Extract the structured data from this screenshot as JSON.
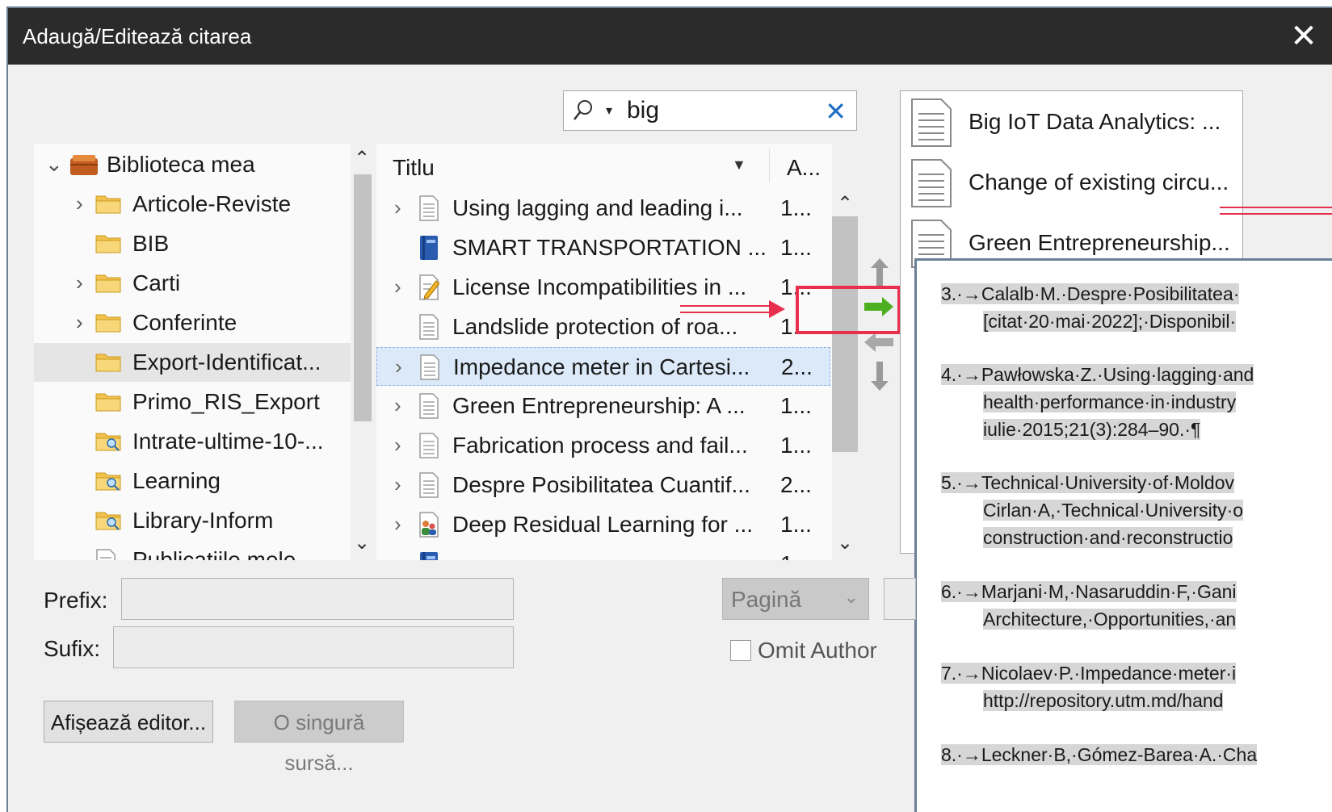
{
  "window": {
    "title": "Adaugă/Editează citarea",
    "close_glyph": "✕"
  },
  "search": {
    "value": "big",
    "clear_glyph": "✕",
    "dropdown_glyph": "▾"
  },
  "tree": {
    "items": [
      {
        "label": "Biblioteca mea",
        "expand": "⌄",
        "icon": "library-icon"
      },
      {
        "label": "Articole-Reviste",
        "expand": "›",
        "icon": "folder-icon"
      },
      {
        "label": "BIB",
        "expand": "",
        "icon": "folder-icon"
      },
      {
        "label": "Carti",
        "expand": "›",
        "icon": "folder-icon"
      },
      {
        "label": "Conferinte",
        "expand": "›",
        "icon": "folder-icon"
      },
      {
        "label": "Export-Identificat...",
        "expand": "",
        "icon": "folder-icon",
        "selected": true
      },
      {
        "label": "Primo_RIS_Export",
        "expand": "",
        "icon": "folder-icon"
      },
      {
        "label": "Intrate-ultime-10-...",
        "expand": "",
        "icon": "search-folder-icon"
      },
      {
        "label": "Learning",
        "expand": "",
        "icon": "search-folder-icon"
      },
      {
        "label": "Library-Inform",
        "expand": "",
        "icon": "search-folder-icon"
      },
      {
        "label": "Publicatiile mele",
        "expand": "",
        "icon": "document-icon"
      }
    ]
  },
  "list": {
    "col_title": "Titlu",
    "col_author": "A...",
    "rows": [
      {
        "title": "Using lagging and leading i...",
        "author": "1...",
        "expand": "›",
        "icon": "document-icon"
      },
      {
        "title": "SMART TRANSPORTATION ...",
        "author": "1...",
        "expand": "",
        "icon": "book-icon"
      },
      {
        "title": "License Incompatibilities in ...",
        "author": "1...",
        "expand": "›",
        "icon": "edit-document-icon"
      },
      {
        "title": "Landslide protection of roa...",
        "author": "1...",
        "expand": "",
        "icon": "document-icon"
      },
      {
        "title": "Impedance meter in Cartesi...",
        "author": "2...",
        "expand": "›",
        "icon": "document-icon",
        "selected": true
      },
      {
        "title": "Green Entrepreneurship: A ...",
        "author": "1...",
        "expand": "›",
        "icon": "document-icon"
      },
      {
        "title": "Fabrication process and fail...",
        "author": "1...",
        "expand": "›",
        "icon": "document-icon"
      },
      {
        "title": "Despre Posibilitatea Cuantif...",
        "author": "2...",
        "expand": "›",
        "icon": "document-icon"
      },
      {
        "title": "Deep Residual Learning for ...",
        "author": "1...",
        "expand": "›",
        "icon": "people-document-icon"
      },
      {
        "title": "",
        "author": "1...",
        "expand": "›",
        "icon": "book-icon"
      }
    ]
  },
  "selected_citations": [
    {
      "title": "Big IoT Data Analytics: ..."
    },
    {
      "title": "Change of existing circu..."
    },
    {
      "title": "Green Entrepreneurship..."
    }
  ],
  "document": {
    "entries": [
      {
        "lines": [
          "3.·→Calalb·M.·Despre·Posibilitatea·",
          "[citat·20·mai·2022];·Disponibil·"
        ]
      },
      {
        "lines": [
          "4.·→Pawłowska·Z.·Using·lagging·and",
          "health·performance·in·industry",
          "iulie·2015;21(3):284–90.·¶"
        ]
      },
      {
        "lines": [
          "5.·→Technical·University·of·Moldov",
          "Cirlan·A,·Technical·University·o",
          "construction·and·reconstructio"
        ]
      },
      {
        "lines": [
          "6.·→Marjani·M,·Nasaruddin·F,·Gani",
          "Architecture,·Opportunities,·an"
        ]
      },
      {
        "lines": [
          "7.·→Nicolaev·P.·Impedance·meter·i",
          "http://repository.utm.md/hand"
        ]
      },
      {
        "lines": [
          "8.·→Leckner·B,·Gómez-Barea·A.·Cha"
        ]
      }
    ]
  },
  "form": {
    "prefix_label": "Prefix:",
    "suffix_label": "Sufix:",
    "prefix_value": "",
    "suffix_value": "",
    "page_select": "Pagină",
    "omit_author": "Omit Author",
    "omit_author_checked": false
  },
  "buttons": {
    "show_editor": "Afișează editor...",
    "single_source": "O singură sursă..."
  },
  "colors": {
    "titlebar": "#2b2b2b",
    "accent": "#1e6fc6",
    "highlight": "#e8304e",
    "insert_arrow": "#4caf1f",
    "selection": "#dbe9f8"
  }
}
